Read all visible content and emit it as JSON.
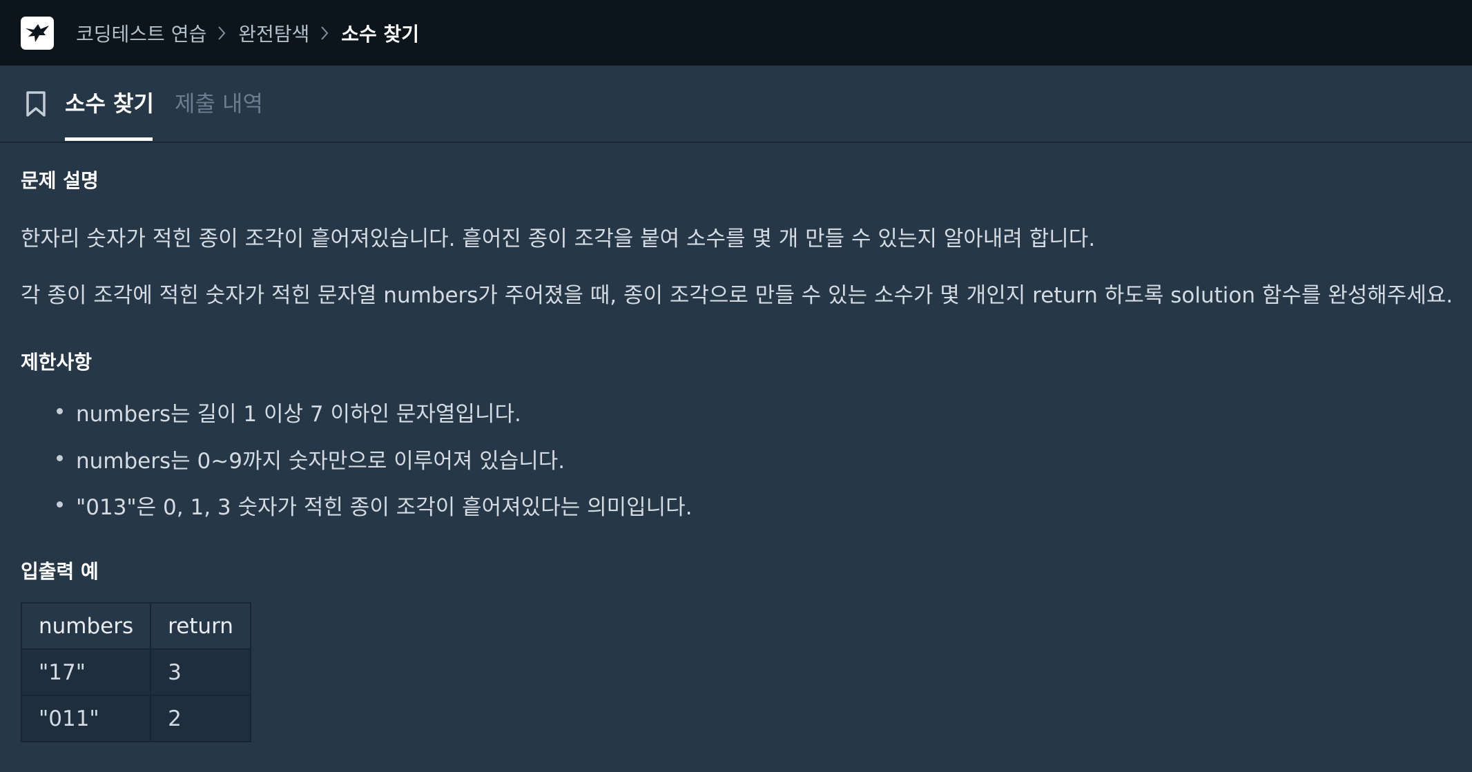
{
  "header": {
    "breadcrumbs": [
      "코딩테스트 연습",
      "완전탐색"
    ],
    "current": "소수 찾기"
  },
  "tabs": {
    "active": "소수 찾기",
    "inactive": "제출 내역"
  },
  "problem": {
    "description_heading": "문제 설명",
    "description": [
      "한자리 숫자가 적힌 종이 조각이 흩어져있습니다. 흩어진 종이 조각을 붙여 소수를 몇 개 만들 수 있는지 알아내려 합니다.",
      "각 종이 조각에 적힌 숫자가 적힌 문자열 numbers가 주어졌을 때, 종이 조각으로 만들 수 있는 소수가 몇 개인지 return 하도록 solution 함수를 완성해주세요."
    ],
    "constraints_heading": "제한사항",
    "constraints": [
      "numbers는 길이 1 이상 7 이하인 문자열입니다.",
      "numbers는 0~9까지 숫자만으로 이루어져 있습니다.",
      "\"013\"은 0, 1, 3 숫자가 적힌 종이 조각이 흩어져있다는 의미입니다."
    ],
    "examples_heading": "입출력 예",
    "examples": {
      "headers": [
        "numbers",
        "return"
      ],
      "rows": [
        [
          "\"17\"",
          "3"
        ],
        [
          "\"011\"",
          "2"
        ]
      ]
    }
  },
  "icons": {
    "logo": "programmers-logo",
    "separator": "chevron-right-icon",
    "tab": "bookmark-icon"
  },
  "colors": {
    "header_bg": "#0c151c",
    "body_bg": "#263747",
    "table_cell_bg": "#1e2e3d",
    "text": "#d5dbe2"
  }
}
